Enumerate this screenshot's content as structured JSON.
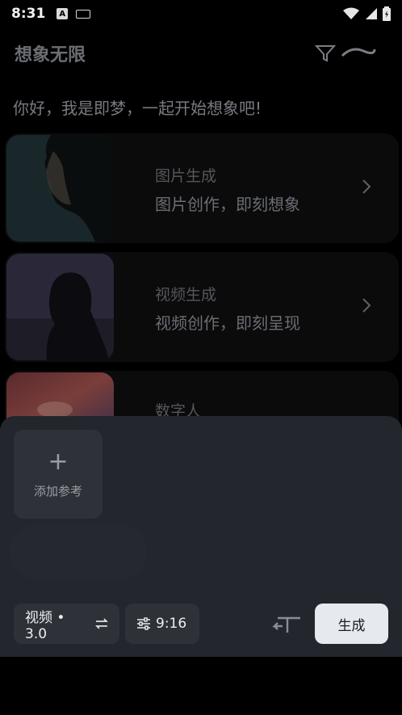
{
  "status_bar": {
    "time": "8:31",
    "notification_letter": "A"
  },
  "header": {
    "title": "想象无限"
  },
  "greeting": "你好，我是即梦，一起开始想象吧!",
  "features": [
    {
      "title": "图片生成",
      "subtitle": "图片创作，即刻想象"
    },
    {
      "title": "视频生成",
      "subtitle": "视频创作，即刻呈现"
    },
    {
      "title": "数字人",
      "subtitle": ""
    }
  ],
  "sheet": {
    "add_reference_label": "添加参考",
    "model_label": "视频 • 3.0",
    "ratio_label": "9:16",
    "generate_label": "生成"
  },
  "colors": {
    "sheet_bg": "#23262c",
    "chip_bg": "#2e3137",
    "generate_bg": "#e6eaee"
  }
}
